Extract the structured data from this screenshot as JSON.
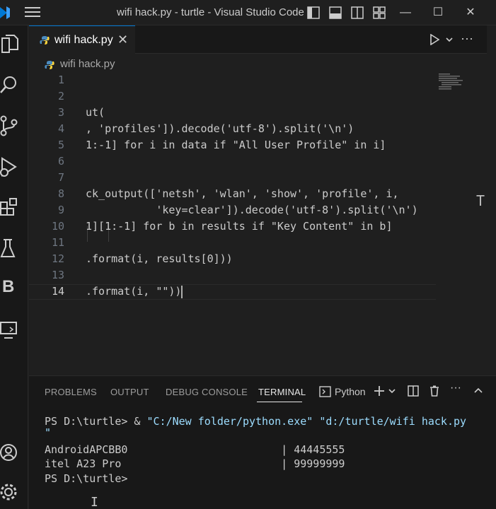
{
  "titlebar": {
    "title": "wifi hack.py - turtle - Visual Studio Code",
    "minimize_glyph": "—",
    "maximize_glyph": "☐",
    "close_glyph": "✕"
  },
  "activity_bar": {
    "icons": [
      "explorer-icon",
      "search-icon",
      "source-control-icon",
      "run-debug-icon",
      "extensions-icon",
      "testing-icon",
      "b-extension-icon",
      "remote-explorer-icon",
      "account-icon",
      "manage-gear-icon"
    ],
    "b_label": "B"
  },
  "editor": {
    "tab_label": "wifi hack.py",
    "tab_close": "✕",
    "breadcrumb": "wifi hack.py",
    "more_actions": "···",
    "lines": [
      {
        "n": "1",
        "text": ""
      },
      {
        "n": "2",
        "text": ""
      },
      {
        "n": "3",
        "text": "ut("
      },
      {
        "n": "4",
        "text": ", 'profiles']).decode('utf-8').split('\\n')"
      },
      {
        "n": "5",
        "text": "1:-1] for i in data if \"All User Profile\" in i]"
      },
      {
        "n": "6",
        "text": ""
      },
      {
        "n": "7",
        "text": ""
      },
      {
        "n": "8",
        "text": "ck_output(['netsh', 'wlan', 'show', 'profile', i,"
      },
      {
        "n": "9",
        "text": "           'key=clear']).decode('utf-8').split('\\n')"
      },
      {
        "n": "10",
        "text": "1][1:-1] for b in results if \"Key Content\" in b]"
      },
      {
        "n": "11",
        "text": ""
      },
      {
        "n": "12",
        "text": ".format(i, results[0]))"
      },
      {
        "n": "13",
        "text": ""
      },
      {
        "n": "14",
        "text": ".format(i, \"\"))"
      }
    ],
    "side_glyph": "T"
  },
  "panel": {
    "tabs": [
      "PROBLEMS",
      "OUTPUT",
      "DEBUG CONSOLE",
      "TERMINAL"
    ],
    "active_tab": "TERMINAL",
    "terminal_profile": "Python",
    "more_actions": "···"
  },
  "terminal": {
    "lines": [
      {
        "prompt": "PS D:\\turtle> & ",
        "cmd1": "\"C:/New folder/python.exe\"",
        "cmd2": " \"d:/turtle/wifi hack.py"
      },
      {
        "text": "\""
      },
      {
        "text": ""
      },
      {
        "text": "AndroidAPCBB0                        | 44445555"
      },
      {
        "text": "itel A23 Pro                         | 99999999"
      },
      {
        "text": "PS D:\\turtle>"
      }
    ]
  },
  "colors": {
    "accent": "#0078d4",
    "string": "#9cdcfe",
    "line_number": "#6e7681",
    "editor_bg": "#1f1f1f"
  }
}
